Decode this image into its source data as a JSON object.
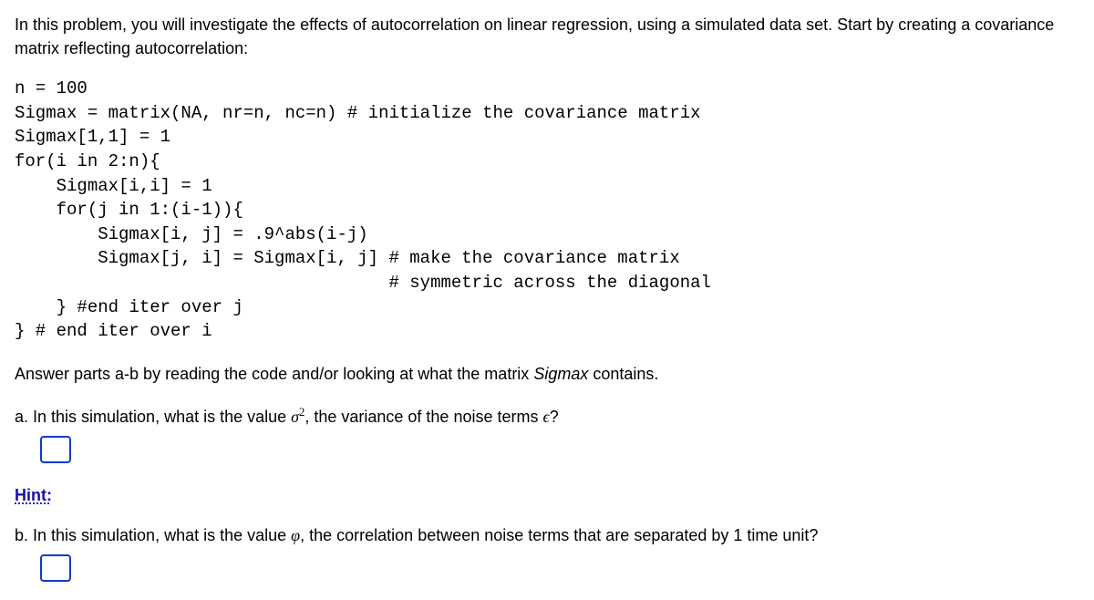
{
  "intro": "In this problem, you will investigate the effects of autocorrelation on linear regression, using a simulated data set. Start by creating a covariance matrix reflecting autocorrelation:",
  "code": "n = 100\nSigmax = matrix(NA, nr=n, nc=n) # initialize the covariance matrix\nSigmax[1,1] = 1\nfor(i in 2:n){\n    Sigmax[i,i] = 1\n    for(j in 1:(i-1)){\n        Sigmax[i, j] = .9^abs(i-j)\n        Sigmax[j, i] = Sigmax[i, j] # make the covariance matrix\n                                    # symmetric across the diagonal\n    } #end iter over j\n} # end iter over i",
  "mid_pre": "Answer parts a-b by reading the code and/or looking at what the matrix ",
  "mid_italic": "Sigmax",
  "mid_post": " contains.",
  "qa": {
    "pre": "a. In this simulation, what is the value ",
    "sigma": "σ",
    "exp": "2",
    "mid": ", the variance of the noise terms ",
    "eps": "ϵ",
    "post": "?"
  },
  "hint": "Hint:",
  "qb": {
    "pre": "b. In this simulation, what is the value ",
    "phi": "φ",
    "post": ", the correlation between noise terms that are separated by 1 time unit?"
  }
}
